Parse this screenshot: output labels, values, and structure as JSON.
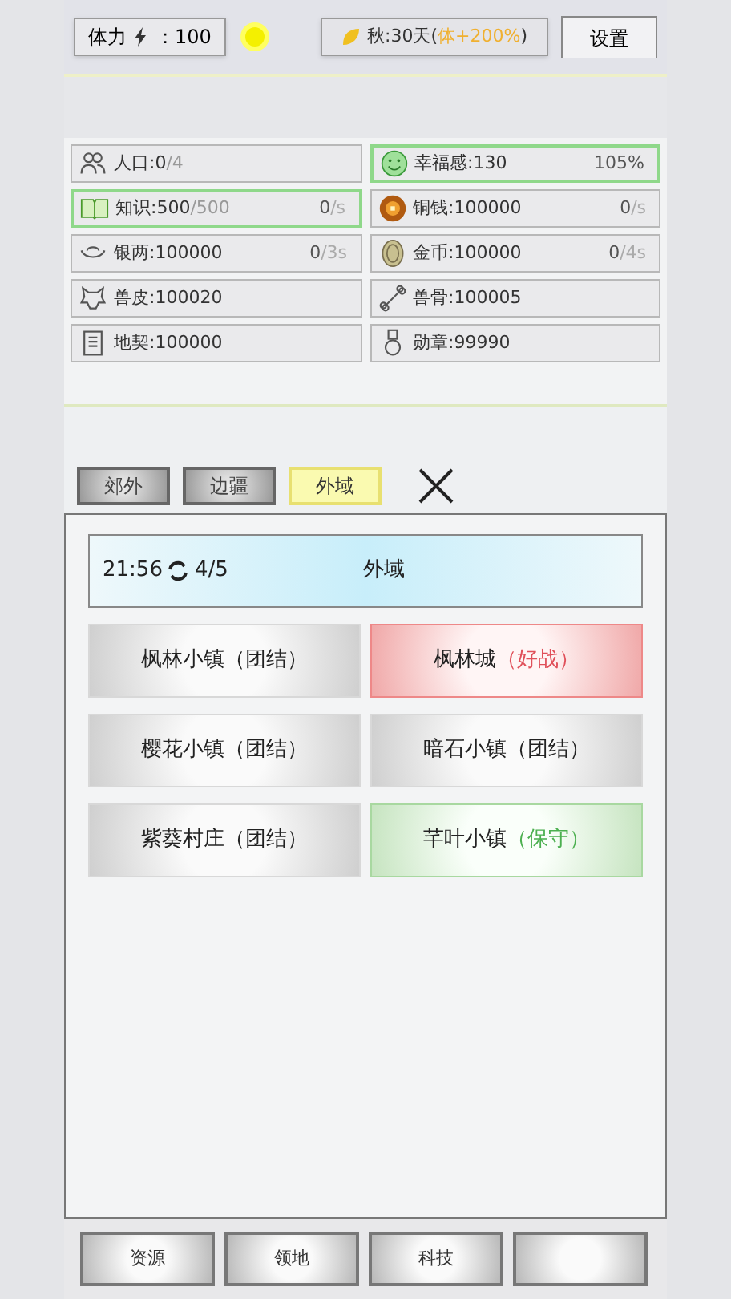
{
  "top_bar": {
    "stamina_label": "体力",
    "stamina_value": "：100",
    "season": "秋:30天(",
    "season_bonus": "体+200%",
    "season_close": ")",
    "settings": "设置"
  },
  "resources": [
    {
      "main": "人口:0",
      "sub": "/4",
      "highlighted": false
    },
    {
      "main": "幸福感:130",
      "rate": "105%",
      "highlighted": true
    },
    {
      "main": "知识:500",
      "sub": "/500",
      "rate": "0",
      "rate_unit": "/s",
      "highlighted": true
    },
    {
      "main": "铜钱:100000",
      "rate": "0",
      "rate_unit": "/s",
      "highlighted": false
    },
    {
      "main": "银两:100000",
      "rate": "0",
      "rate_unit": "/3s",
      "highlighted": false
    },
    {
      "main": "金币:100000",
      "rate": "0",
      "rate_unit": "/4s",
      "highlighted": false
    },
    {
      "main": "兽皮:100020",
      "highlighted": false
    },
    {
      "main": "兽骨:100005",
      "highlighted": false
    },
    {
      "main": "地契:100000",
      "highlighted": false
    },
    {
      "main": "勋章:99990",
      "highlighted": false
    }
  ],
  "tabs": [
    {
      "label": "郊外",
      "selected": false
    },
    {
      "label": "边疆",
      "selected": false
    },
    {
      "label": "外域",
      "selected": true
    }
  ],
  "region_header": {
    "time": "21:56",
    "count": "4/5",
    "title": "外域"
  },
  "towns": [
    {
      "name": "枫林小镇",
      "stance": "（团结）",
      "kind": "united"
    },
    {
      "name": "枫林城",
      "stance": "（好战）",
      "kind": "hostile"
    },
    {
      "name": "樱花小镇",
      "stance": "（团结）",
      "kind": "united"
    },
    {
      "name": "暗石小镇",
      "stance": "（团结）",
      "kind": "united"
    },
    {
      "name": "紫葵村庄",
      "stance": "（团结）",
      "kind": "united"
    },
    {
      "name": "芊叶小镇",
      "stance": "（保守）",
      "kind": "neutral"
    }
  ],
  "bottom_nav": [
    {
      "label": "资源"
    },
    {
      "label": "领地"
    },
    {
      "label": "科技"
    }
  ]
}
